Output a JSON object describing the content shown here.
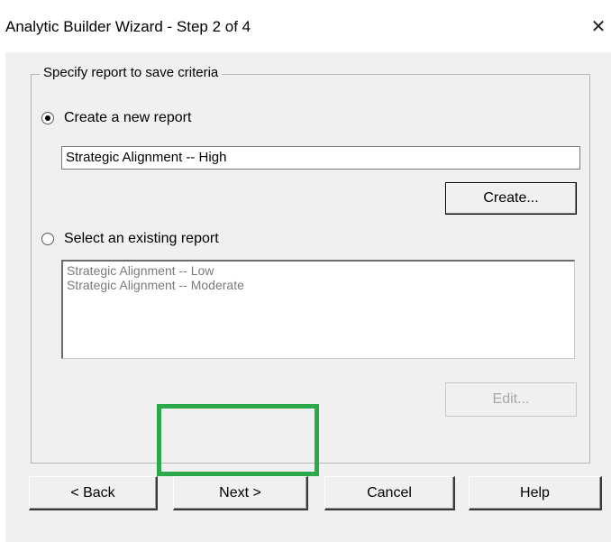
{
  "window": {
    "title": "Analytic Builder Wizard - Step 2 of 4",
    "close_glyph": "✕"
  },
  "group": {
    "legend": "Specify report to save criteria"
  },
  "create_option": {
    "label": "Create a new report",
    "selected": true,
    "name_value": "Strategic Alignment -- High",
    "create_button": "Create..."
  },
  "existing_option": {
    "label": "Select an existing report",
    "selected": false,
    "reports": [
      "Strategic Alignment -- Low",
      "Strategic Alignment -- Moderate"
    ],
    "edit_button": "Edit..."
  },
  "footer": {
    "back_label": "< Back",
    "next_label": "Next >",
    "cancel_label": "Cancel",
    "help_label": "Help"
  },
  "highlight_color": "#2aa84a"
}
